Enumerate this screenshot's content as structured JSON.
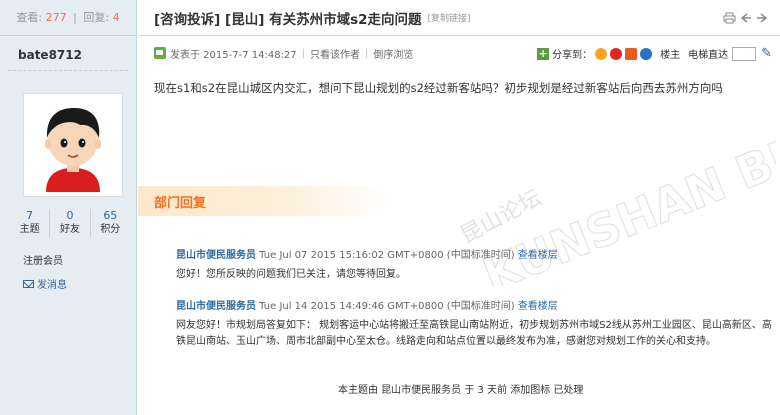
{
  "left": {
    "views_label": "查看:",
    "views": "277",
    "replies_label": "回复:",
    "replies": "4",
    "username": "bate8712",
    "counts": [
      {
        "num": "7",
        "label": "主题"
      },
      {
        "num": "0",
        "label": "好友"
      },
      {
        "num": "65",
        "label": "积分"
      }
    ],
    "role": "注册会员",
    "send_message": "发消息"
  },
  "thread": {
    "title": "[咨询投诉] [昆山] 有关苏州市域s2走向问题",
    "copy_link": "[复制链接]"
  },
  "postinfo": {
    "posted": "发表于 2015-7-7 14:48:27",
    "author_only": "只看该作者",
    "reverse": "倒序浏览",
    "share": "分享到：",
    "floor": "楼主",
    "goto": "电梯直达"
  },
  "post_body": "现在s1和s2在昆山城区内交汇，想问下昆山规划的s2经过新客站吗？初步规划是经过新客站后向西去苏州方向吗",
  "watermark": {
    "cn": "昆山论坛",
    "en": "KUNSHAN BBS"
  },
  "dept_reply": "部门回复",
  "replies": [
    {
      "name": "昆山市便民服务员",
      "time": " Tue Jul 07 2015 15:16:02 GMT+0800 (中国标准时间) ",
      "link": "查看楼层",
      "body": "您好！您所反映的问题我们已关注，请您等待回复。"
    },
    {
      "name": "昆山市便民服务员",
      "time": " Tue Jul 14 2015 14:49:46 GMT+0800 (中国标准时间) ",
      "link": "查看楼层",
      "body": "网友您好！市规划局答复如下： 规划客运中心站将搬迁至高铁昆山南站附近，初步规划苏州市域S2线从苏州工业园区、昆山高新区、高铁昆山南站、玉山广场、周市北部副中心至太仓。线路走向和站点位置以最终发布为准，感谢您对规划工作的关心和支持。"
    }
  ],
  "footer": "本主题由 昆山市便民服务员 于 3 天前 添加图标 已处理"
}
